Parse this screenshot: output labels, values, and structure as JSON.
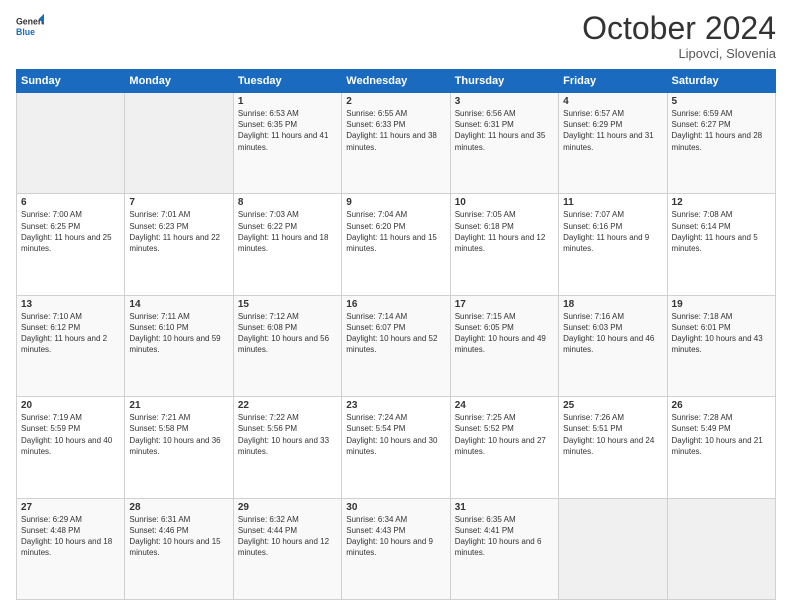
{
  "header": {
    "logo_general": "General",
    "logo_blue": "Blue",
    "month": "October 2024",
    "location": "Lipovci, Slovenia"
  },
  "weekdays": [
    "Sunday",
    "Monday",
    "Tuesday",
    "Wednesday",
    "Thursday",
    "Friday",
    "Saturday"
  ],
  "weeks": [
    [
      {
        "day": "",
        "info": ""
      },
      {
        "day": "",
        "info": ""
      },
      {
        "day": "1",
        "info": "Sunrise: 6:53 AM\nSunset: 6:35 PM\nDaylight: 11 hours and 41 minutes."
      },
      {
        "day": "2",
        "info": "Sunrise: 6:55 AM\nSunset: 6:33 PM\nDaylight: 11 hours and 38 minutes."
      },
      {
        "day": "3",
        "info": "Sunrise: 6:56 AM\nSunset: 6:31 PM\nDaylight: 11 hours and 35 minutes."
      },
      {
        "day": "4",
        "info": "Sunrise: 6:57 AM\nSunset: 6:29 PM\nDaylight: 11 hours and 31 minutes."
      },
      {
        "day": "5",
        "info": "Sunrise: 6:59 AM\nSunset: 6:27 PM\nDaylight: 11 hours and 28 minutes."
      }
    ],
    [
      {
        "day": "6",
        "info": "Sunrise: 7:00 AM\nSunset: 6:25 PM\nDaylight: 11 hours and 25 minutes."
      },
      {
        "day": "7",
        "info": "Sunrise: 7:01 AM\nSunset: 6:23 PM\nDaylight: 11 hours and 22 minutes."
      },
      {
        "day": "8",
        "info": "Sunrise: 7:03 AM\nSunset: 6:22 PM\nDaylight: 11 hours and 18 minutes."
      },
      {
        "day": "9",
        "info": "Sunrise: 7:04 AM\nSunset: 6:20 PM\nDaylight: 11 hours and 15 minutes."
      },
      {
        "day": "10",
        "info": "Sunrise: 7:05 AM\nSunset: 6:18 PM\nDaylight: 11 hours and 12 minutes."
      },
      {
        "day": "11",
        "info": "Sunrise: 7:07 AM\nSunset: 6:16 PM\nDaylight: 11 hours and 9 minutes."
      },
      {
        "day": "12",
        "info": "Sunrise: 7:08 AM\nSunset: 6:14 PM\nDaylight: 11 hours and 5 minutes."
      }
    ],
    [
      {
        "day": "13",
        "info": "Sunrise: 7:10 AM\nSunset: 6:12 PM\nDaylight: 11 hours and 2 minutes."
      },
      {
        "day": "14",
        "info": "Sunrise: 7:11 AM\nSunset: 6:10 PM\nDaylight: 10 hours and 59 minutes."
      },
      {
        "day": "15",
        "info": "Sunrise: 7:12 AM\nSunset: 6:08 PM\nDaylight: 10 hours and 56 minutes."
      },
      {
        "day": "16",
        "info": "Sunrise: 7:14 AM\nSunset: 6:07 PM\nDaylight: 10 hours and 52 minutes."
      },
      {
        "day": "17",
        "info": "Sunrise: 7:15 AM\nSunset: 6:05 PM\nDaylight: 10 hours and 49 minutes."
      },
      {
        "day": "18",
        "info": "Sunrise: 7:16 AM\nSunset: 6:03 PM\nDaylight: 10 hours and 46 minutes."
      },
      {
        "day": "19",
        "info": "Sunrise: 7:18 AM\nSunset: 6:01 PM\nDaylight: 10 hours and 43 minutes."
      }
    ],
    [
      {
        "day": "20",
        "info": "Sunrise: 7:19 AM\nSunset: 5:59 PM\nDaylight: 10 hours and 40 minutes."
      },
      {
        "day": "21",
        "info": "Sunrise: 7:21 AM\nSunset: 5:58 PM\nDaylight: 10 hours and 36 minutes."
      },
      {
        "day": "22",
        "info": "Sunrise: 7:22 AM\nSunset: 5:56 PM\nDaylight: 10 hours and 33 minutes."
      },
      {
        "day": "23",
        "info": "Sunrise: 7:24 AM\nSunset: 5:54 PM\nDaylight: 10 hours and 30 minutes."
      },
      {
        "day": "24",
        "info": "Sunrise: 7:25 AM\nSunset: 5:52 PM\nDaylight: 10 hours and 27 minutes."
      },
      {
        "day": "25",
        "info": "Sunrise: 7:26 AM\nSunset: 5:51 PM\nDaylight: 10 hours and 24 minutes."
      },
      {
        "day": "26",
        "info": "Sunrise: 7:28 AM\nSunset: 5:49 PM\nDaylight: 10 hours and 21 minutes."
      }
    ],
    [
      {
        "day": "27",
        "info": "Sunrise: 6:29 AM\nSunset: 4:48 PM\nDaylight: 10 hours and 18 minutes."
      },
      {
        "day": "28",
        "info": "Sunrise: 6:31 AM\nSunset: 4:46 PM\nDaylight: 10 hours and 15 minutes."
      },
      {
        "day": "29",
        "info": "Sunrise: 6:32 AM\nSunset: 4:44 PM\nDaylight: 10 hours and 12 minutes."
      },
      {
        "day": "30",
        "info": "Sunrise: 6:34 AM\nSunset: 4:43 PM\nDaylight: 10 hours and 9 minutes."
      },
      {
        "day": "31",
        "info": "Sunrise: 6:35 AM\nSunset: 4:41 PM\nDaylight: 10 hours and 6 minutes."
      },
      {
        "day": "",
        "info": ""
      },
      {
        "day": "",
        "info": ""
      }
    ]
  ]
}
